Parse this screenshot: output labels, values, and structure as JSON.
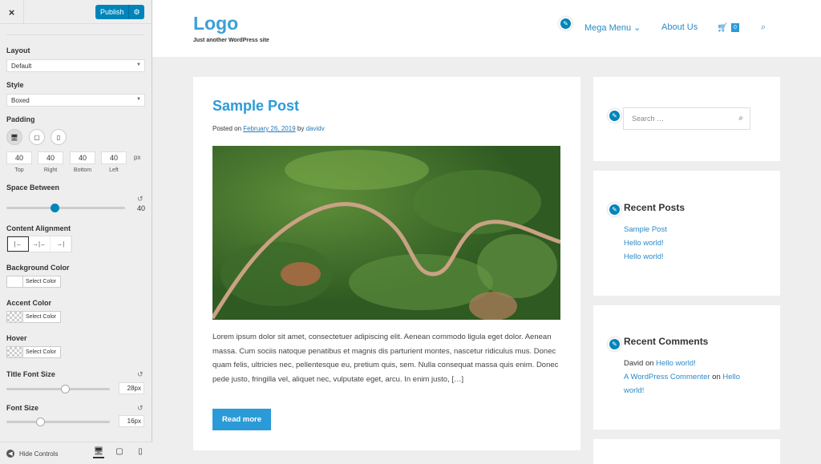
{
  "customizer": {
    "close_icon": "×",
    "publish": "Publish",
    "gear_icon": "⚙",
    "layout_label": "Layout",
    "layout_value": "Default",
    "style_label": "Style",
    "style_value": "Boxed",
    "padding_label": "Padding",
    "padding_values": [
      "40",
      "40",
      "40",
      "40"
    ],
    "padding_unit": "px",
    "padding_sides": [
      "Top",
      "Right",
      "Bottom",
      "Left"
    ],
    "space_label": "Space Between",
    "space_value": "40",
    "content_align_label": "Content Alignment",
    "bg_color_label": "Background Color",
    "accent_label": "Accent Color",
    "hover_label": "Hover",
    "select_color": "Select Color",
    "title_font_label": "Title Font Size",
    "title_font_value": "28px",
    "font_size_label": "Font Size",
    "font_size_value": "16px",
    "hide_controls": "Hide Controls"
  },
  "site": {
    "logo": "Logo",
    "tagline": "Just another WordPress site",
    "nav": [
      "Mega Menu",
      "About Us"
    ],
    "cart_count": "0",
    "post": {
      "title": "Sample Post",
      "posted_on": "Posted on",
      "date": "February 26, 2019",
      "by": "by",
      "author": "davidv",
      "excerpt": "Lorem ipsum dolor sit amet, consectetuer adipiscing elit. Aenean commodo ligula eget dolor. Aenean massa. Cum sociis natoque penatibus et magnis dis parturient montes, nascetur ridiculus mus. Donec quam felis, ultricies nec, pellentesque eu, pretium quis, sem. Nulla consequat massa quis enim. Donec pede justo, fringilla vel, aliquet nec, vulputate eget, arcu. In enim justo, […]",
      "read_more": "Read more"
    },
    "search_placeholder": "Search …",
    "recent_posts_title": "Recent Posts",
    "recent_posts": [
      "Sample Post",
      "Hello world!",
      "Hello world!"
    ],
    "recent_comments_title": "Recent Comments",
    "comment1_author": "David",
    "comment1_on": "on",
    "comment1_link": "Hello world!",
    "comment2_author": "A WordPress Commenter",
    "comment2_on": "on",
    "comment2_link_a": "Hello",
    "comment2_link_b": "world!"
  },
  "colors": {
    "accent": "#2a9bd8",
    "publish": "#0085ba"
  }
}
